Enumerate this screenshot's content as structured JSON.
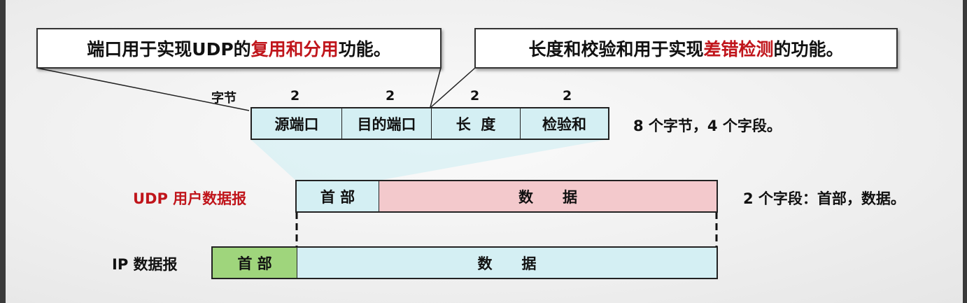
{
  "callouts": {
    "port": {
      "before": "端口用于实现UDP的",
      "highlight": "复用和分用",
      "after": "功能。"
    },
    "length_checksum": {
      "before": "长度和校验和用于实现",
      "highlight": "差错检测",
      "after": "的功能。"
    }
  },
  "udp_header": {
    "bytes_label": "字节",
    "field_sizes": [
      "2",
      "2",
      "2",
      "2"
    ],
    "fields": [
      "源端口",
      "目的端口",
      "长  度",
      "检验和"
    ],
    "summary": "8 个字节，4 个字段。"
  },
  "udp_datagram": {
    "label": "UDP 用户数据报",
    "header": "首 部",
    "data": "数　　据",
    "summary": "2 个字段：首部，数据。"
  },
  "ip_datagram": {
    "label": "IP 数据报",
    "header": "首 部",
    "data": "数　　据"
  },
  "colors": {
    "highlight": "#c0151b",
    "header_fill": "#d4eff3",
    "udp_data_fill": "#f3c9cc",
    "ip_header_fill": "#9fd57c"
  }
}
